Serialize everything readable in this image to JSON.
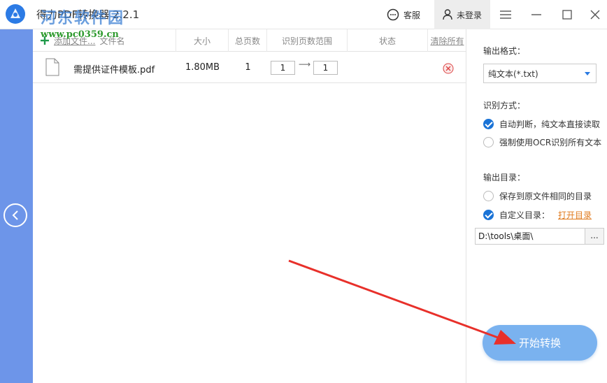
{
  "titlebar": {
    "app_title": "得力PDF转换器 2.2.1",
    "watermark_site": "河东软件园",
    "watermark_url": "www.pc0359.cn",
    "service_label": "客服",
    "user_label": "未登录"
  },
  "file_table": {
    "add_label": "添加文件...",
    "col_filename": "文件名",
    "col_size": "大小",
    "col_pages": "总页数",
    "col_range": "识别页数范围",
    "col_status": "状态",
    "clear_label": "清除所有",
    "rows": [
      {
        "name": "需提供证件模板.pdf",
        "size": "1.80MB",
        "pages": "1",
        "range_from": "1",
        "range_to": "1",
        "status": ""
      }
    ]
  },
  "settings": {
    "output_format_label": "输出格式：",
    "output_format_value": "纯文本(*.txt)",
    "recognize_label": "识别方式：",
    "recognize_option_auto": "自动判断，纯文本直接读取",
    "recognize_option_ocr": "强制使用OCR识别所有文本",
    "output_dir_label": "输出目录：",
    "dir_option_same": "保存到原文件相同的目录",
    "dir_option_custom": "自定义目录：",
    "open_dir_link": "打开目录",
    "path_value": "D:\\tools\\桌面\\",
    "browse_label": "...",
    "start_button": "开始转换"
  },
  "colors": {
    "accent_blue": "#1a73d6",
    "left_strip": "#6d95e9",
    "start_button": "#7ab2ef",
    "link_orange": "#e07b1f",
    "arrow_red": "#e8302a"
  }
}
